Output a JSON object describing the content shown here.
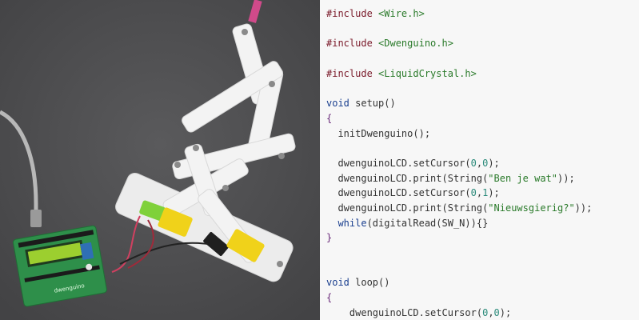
{
  "photo": {
    "alt_subject": "dwenguino board with robotic arm",
    "board_label": "dwenguino"
  },
  "code": {
    "lines": [
      {
        "parts": [
          {
            "t": "#include ",
            "c": "kw"
          },
          {
            "t": "<Wire.h>",
            "c": "hdr"
          }
        ]
      },
      {
        "parts": [
          {
            "t": "",
            "c": "fn"
          }
        ]
      },
      {
        "parts": [
          {
            "t": "#include ",
            "c": "kw"
          },
          {
            "t": "<Dwenguino.h>",
            "c": "hdr"
          }
        ]
      },
      {
        "parts": [
          {
            "t": "",
            "c": "fn"
          }
        ]
      },
      {
        "parts": [
          {
            "t": "#include ",
            "c": "kw"
          },
          {
            "t": "<LiquidCrystal.h>",
            "c": "hdr"
          }
        ]
      },
      {
        "parts": [
          {
            "t": "",
            "c": "fn"
          }
        ]
      },
      {
        "parts": [
          {
            "t": "void ",
            "c": "kwb"
          },
          {
            "t": "setup()",
            "c": "fn"
          }
        ]
      },
      {
        "parts": [
          {
            "t": "{",
            "c": "br"
          }
        ]
      },
      {
        "parts": [
          {
            "t": "  initDwenguino();",
            "c": "fn"
          }
        ]
      },
      {
        "parts": [
          {
            "t": "",
            "c": "fn"
          }
        ]
      },
      {
        "parts": [
          {
            "t": "  dwenguinoLCD.setCursor(",
            "c": "fn"
          },
          {
            "t": "0",
            "c": "num"
          },
          {
            "t": ",",
            "c": "fn"
          },
          {
            "t": "0",
            "c": "num"
          },
          {
            "t": ");",
            "c": "fn"
          }
        ]
      },
      {
        "parts": [
          {
            "t": "  dwenguinoLCD.print(String(",
            "c": "fn"
          },
          {
            "t": "\"Ben je wat\"",
            "c": "str"
          },
          {
            "t": "));",
            "c": "fn"
          }
        ]
      },
      {
        "parts": [
          {
            "t": "  dwenguinoLCD.setCursor(",
            "c": "fn"
          },
          {
            "t": "0",
            "c": "num"
          },
          {
            "t": ",",
            "c": "fn"
          },
          {
            "t": "1",
            "c": "num"
          },
          {
            "t": ");",
            "c": "fn"
          }
        ]
      },
      {
        "parts": [
          {
            "t": "  dwenguinoLCD.print(String(",
            "c": "fn"
          },
          {
            "t": "\"Nieuwsgierig?\"",
            "c": "str"
          },
          {
            "t": "));",
            "c": "fn"
          }
        ]
      },
      {
        "parts": [
          {
            "t": "  ",
            "c": "fn"
          },
          {
            "t": "while",
            "c": "kwb"
          },
          {
            "t": "(digitalRead(SW_N)){}",
            "c": "fn"
          }
        ]
      },
      {
        "parts": [
          {
            "t": "}",
            "c": "br"
          }
        ]
      },
      {
        "parts": [
          {
            "t": "",
            "c": "fn"
          }
        ]
      },
      {
        "parts": [
          {
            "t": "",
            "c": "fn"
          }
        ]
      },
      {
        "parts": [
          {
            "t": "void ",
            "c": "kwb"
          },
          {
            "t": "loop()",
            "c": "fn"
          }
        ]
      },
      {
        "parts": [
          {
            "t": "{",
            "c": "br"
          }
        ]
      },
      {
        "parts": [
          {
            "t": "    dwenguinoLCD.setCursor(",
            "c": "fn"
          },
          {
            "t": "0",
            "c": "num"
          },
          {
            "t": ",",
            "c": "fn"
          },
          {
            "t": "0",
            "c": "num"
          },
          {
            "t": ");",
            "c": "fn"
          }
        ]
      }
    ]
  }
}
